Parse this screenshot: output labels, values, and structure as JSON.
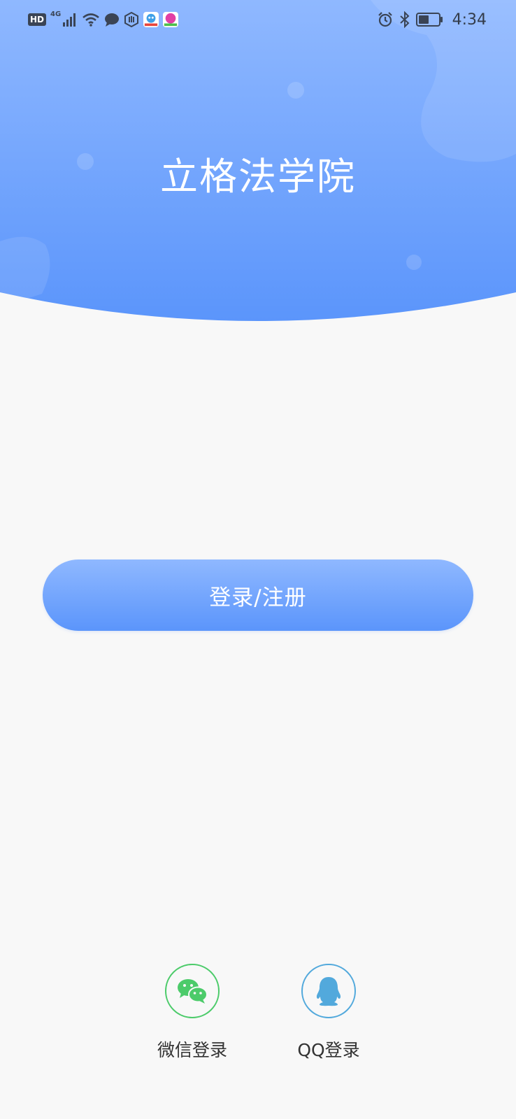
{
  "status_bar": {
    "hd_label": "HD",
    "network_label": "4G",
    "time": "4:34",
    "icons": [
      "hd-icon",
      "signal-icon",
      "wifi-icon",
      "message-icon",
      "hand-icon",
      "app-badge-icon",
      "app-badge-icon",
      "alarm-icon",
      "bluetooth-icon",
      "battery-icon"
    ]
  },
  "header": {
    "title": "立格法学院",
    "gradient_top": "#8fb8ff",
    "gradient_bottom": "#5b95fb"
  },
  "main": {
    "login_button_label": "登录/注册"
  },
  "social_login": {
    "wechat_label": "微信登录",
    "wechat_color": "#4ccb6a",
    "qq_label": "QQ登录",
    "qq_color": "#52a9dc"
  }
}
